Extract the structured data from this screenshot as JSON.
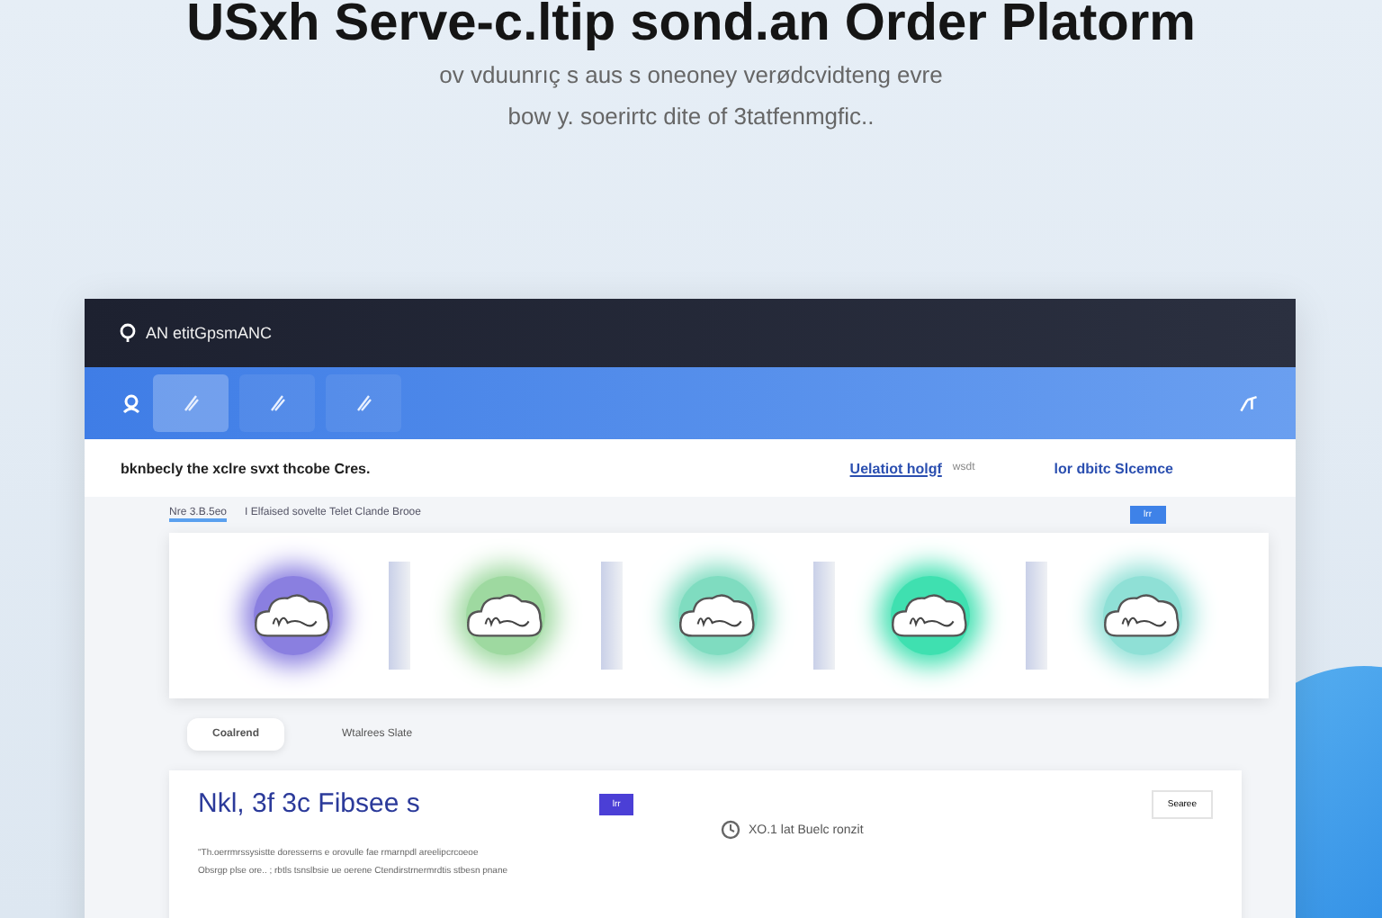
{
  "hero": {
    "title": "USxh Serve-c.ltip sond.an Order Platorm",
    "subtitle_lines": [
      "ov vduunrıç s aus s oneoney verødcvidteng evre",
      "bow y. soerirtc dite of 3tatfenmgfic.."
    ]
  },
  "app": {
    "brand": "AN etitGpsmANC",
    "nav_tabs": [
      {
        "selected": true
      },
      {
        "selected": false
      },
      {
        "selected": false
      }
    ],
    "heading": "bknbecly the xclre svxt thcobe Cres.",
    "link": "Uelatiot holgf",
    "link_note": "wsdt",
    "side_title": "lor dbitc Slcemce",
    "filter_tabs": [
      {
        "label": "Nre 3.B.5eo",
        "selected": true
      },
      {
        "label": "I Elfaised sovelte Telet Clande Brooe",
        "selected": false
      }
    ],
    "filter_button": "lrr",
    "cards": [
      {
        "color": "#8a7fe0"
      },
      {
        "color": "#9ed9a0"
      },
      {
        "color": "#7fdcc0"
      },
      {
        "color": "#3fe0b0"
      },
      {
        "color": "#8fe0d6"
      }
    ],
    "lower_tabs": [
      {
        "label": "Coalrend",
        "selected": true
      },
      {
        "label": "Wtalrees Slate",
        "selected": false
      }
    ],
    "panel": {
      "title": "Nkl, 3f 3c Fibsee s",
      "tag": "lrr",
      "action": "Searee",
      "meta": "XO.1 lat Buelc ronzit",
      "lines": [
        "\"Th.oerrmrssysistte doresserns e orovulle fae rmarnpdl areelipcrcoeoe",
        "Obsrgp plse ore.. ; rbtls tsnslbsie ue oerene Ctendirstrnermrdtis stbesn  pnane"
      ]
    }
  }
}
